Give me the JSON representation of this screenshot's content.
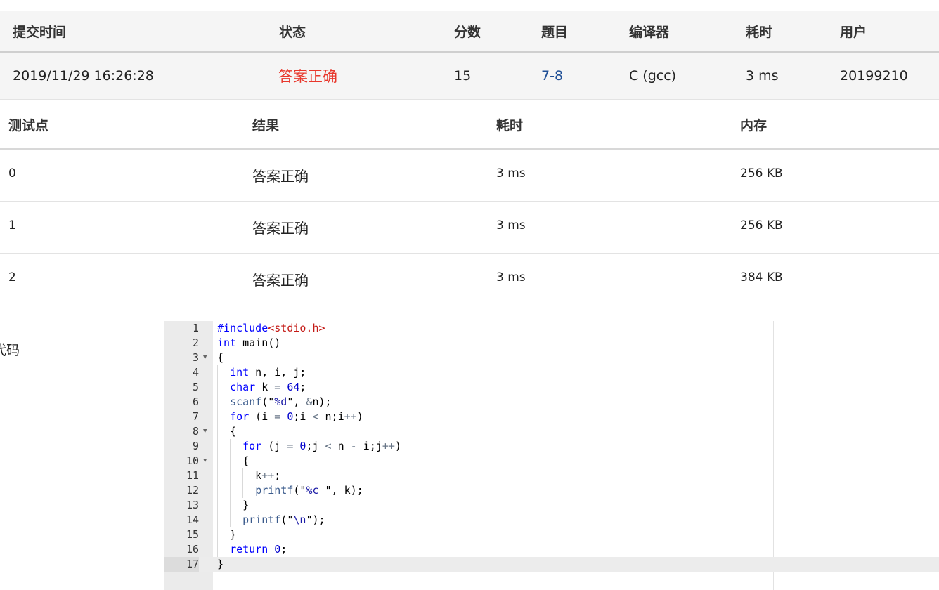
{
  "submission": {
    "headers": [
      "提交时间",
      "状态",
      "分数",
      "题目",
      "编译器",
      "耗时",
      "用户"
    ],
    "row": {
      "time": "2019/11/29 16:26:28",
      "status": "答案正确",
      "score": "15",
      "problem": "7-8",
      "compiler": "C (gcc)",
      "elapsed": "3 ms",
      "user": "20199210"
    }
  },
  "cases": {
    "headers": [
      "测试点",
      "结果",
      "耗时",
      "内存"
    ],
    "rows": [
      {
        "id": "0",
        "result": "答案正确",
        "time": "3 ms",
        "memory": "256 KB"
      },
      {
        "id": "1",
        "result": "答案正确",
        "time": "3 ms",
        "memory": "256 KB"
      },
      {
        "id": "2",
        "result": "答案正确",
        "time": "3 ms",
        "memory": "384 KB"
      }
    ]
  },
  "code_label": "代码",
  "code": {
    "active_line": 17,
    "lines": [
      {
        "n": "1",
        "fold": false
      },
      {
        "n": "2",
        "fold": false
      },
      {
        "n": "3",
        "fold": true
      },
      {
        "n": "4",
        "fold": false
      },
      {
        "n": "5",
        "fold": false
      },
      {
        "n": "6",
        "fold": false
      },
      {
        "n": "7",
        "fold": false
      },
      {
        "n": "8",
        "fold": true
      },
      {
        "n": "9",
        "fold": false
      },
      {
        "n": "10",
        "fold": true
      },
      {
        "n": "11",
        "fold": false
      },
      {
        "n": "12",
        "fold": false
      },
      {
        "n": "13",
        "fold": false
      },
      {
        "n": "14",
        "fold": false
      },
      {
        "n": "15",
        "fold": false
      },
      {
        "n": "16",
        "fold": false
      },
      {
        "n": "17",
        "fold": false
      }
    ],
    "source": [
      "#include<stdio.h>",
      "int main()",
      "{",
      "  int n, i, j;",
      "  char k = 64;",
      "  scanf(\"%d\", &n);",
      "  for (i = 0;i < n;i++)",
      "  {",
      "    for (j = 0;j < n - i;j++)",
      "    {",
      "      k++;",
      "      printf(\"%c \", k);",
      "    }",
      "    printf(\"\\n\");",
      "  }",
      "  return 0;",
      "}"
    ]
  },
  "icons": {
    "fold": "fold-arrow-icon"
  }
}
